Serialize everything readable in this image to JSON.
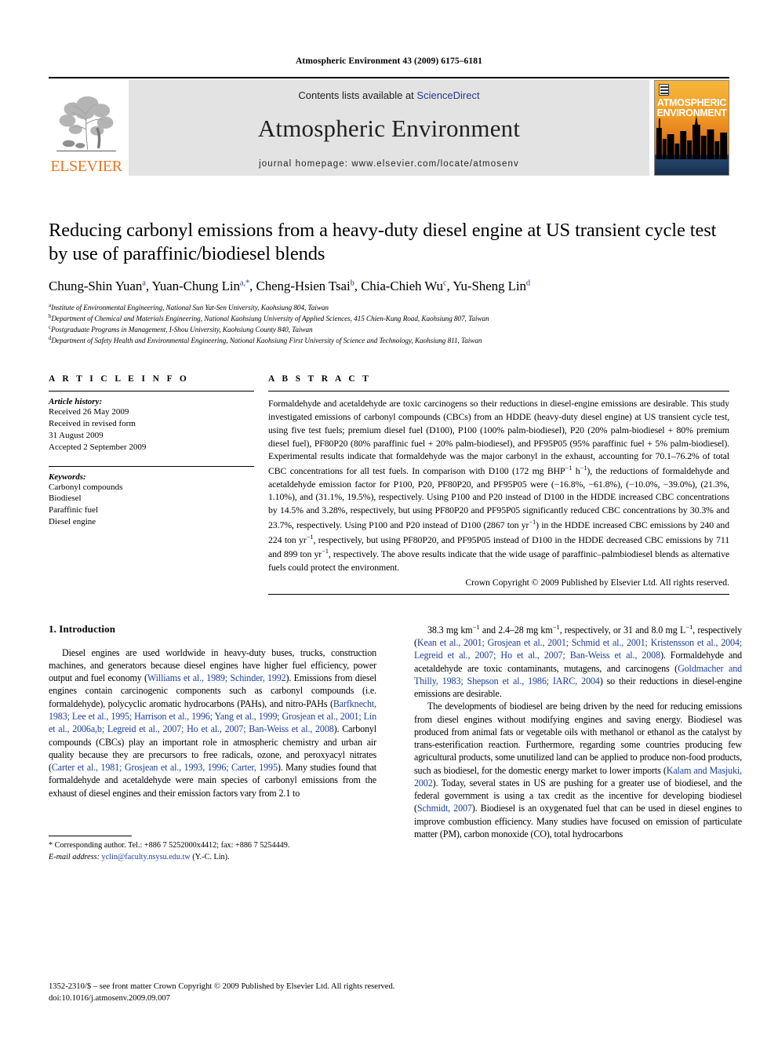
{
  "running_head": "Atmospheric Environment 43 (2009) 6175–6181",
  "masthead": {
    "contents_prefix": "Contents lists available at ",
    "sciencedirect": "ScienceDirect",
    "journal_title": "Atmospheric Environment",
    "homepage": "journal homepage: www.elsevier.com/locate/atmosenv",
    "publisher_name": "ELSEVIER",
    "cover_title_line1": "ATMOSPHERIC",
    "cover_title_line2": "ENVIRONMENT",
    "accent_orange": "#E87722",
    "link_blue": "#2b3a8f",
    "masthead_bg": "#e3e3e3"
  },
  "article": {
    "title": "Reducing carbonyl emissions from a heavy-duty diesel engine at US transient cycle test by use of paraffinic/biodiesel blends",
    "authors": [
      {
        "name": "Chung-Shin Yuan",
        "marks": "a",
        "sep": ", "
      },
      {
        "name": "Yuan-Chung Lin",
        "marks": "a,*",
        "sep": ", "
      },
      {
        "name": "Cheng-Hsien Tsai",
        "marks": "b",
        "sep": ", "
      },
      {
        "name": "Chia-Chieh Wu",
        "marks": "c",
        "sep": ", "
      },
      {
        "name": "Yu-Sheng Lin",
        "marks": "d",
        "sep": ""
      }
    ],
    "affiliations": [
      {
        "mark": "a",
        "text": "Institute of Environmental Engineering, National Sun Yat-Sen University, Kaohsiung 804, Taiwan"
      },
      {
        "mark": "b",
        "text": "Department of Chemical and Materials Engineering, National Kaohsiung University of Applied Sciences, 415 Chien-Kung Road, Kaohsiung 807, Taiwan"
      },
      {
        "mark": "c",
        "text": "Postgraduate Programs in Management, I-Shou University, Kaohsiung County 840, Taiwan"
      },
      {
        "mark": "d",
        "text": "Department of Safety Health and Environmental Engineering, National Kaohsiung First University of Science and Technology, Kaohsiung 811, Taiwan"
      }
    ]
  },
  "article_info": {
    "heading": "A R T I C L E  I N F O",
    "history_label": "Article history:",
    "history": [
      "Received 26 May 2009",
      "Received in revised form",
      "31 August 2009",
      "Accepted 2 September 2009"
    ],
    "keywords_label": "Keywords:",
    "keywords": [
      "Carbonyl compounds",
      "Biodiesel",
      "Paraffinic fuel",
      "Diesel engine"
    ]
  },
  "abstract": {
    "heading": "A B S T R A C T",
    "paragraph_html": "Formaldehyde and acetaldehyde are toxic carcinogens so their reductions in diesel-engine emissions are desirable. This study investigated emissions of carbonyl compounds (CBCs) from an HDDE (heavy-duty diesel engine) at US transient cycle test, using five test fuels; premium diesel fuel (D100), P100 (100% palm-biodiesel), P20 (20% palm-biodiesel + 80% premium diesel fuel), PF80P20 (80% paraffinic fuel + 20% palm-biodiesel), and PF95P05 (95% paraffinic fuel + 5% palm-biodiesel). Experimental results indicate that formaldehyde was the major carbonyl in the exhaust, accounting for 70.1–76.2% of total CBC concentrations for all test fuels. In comparison with D100 (172 mg BHP<sup class=\"sm\">−1</sup> h<sup class=\"sm\">−1</sup>), the reductions of formaldehyde and acetaldehyde emission factor for P100, P20, PF80P20, and PF95P05 were (−16.8%, −61.8%), (−10.0%, −39.0%), (21.3%, 1.10%), and (31.1%, 19.5%), respectively. Using P100 and P20 instead of D100 in the HDDE increased CBC concentrations by 14.5% and 3.28%, respectively, but using PF80P20 and PF95P05 significantly reduced CBC concentrations by 30.3% and 23.7%, respectively. Using P100 and P20 instead of D100 (2867 ton yr<sup class=\"sm\">−1</sup>) in the HDDE increased CBC emissions by 240 and 224 ton yr<sup class=\"sm\">−1</sup>, respectively, but using PF80P20, and PF95P05 instead of D100 in the HDDE decreased CBC emissions by 711 and 899 ton yr<sup class=\"sm\">−1</sup>, respectively. The above results indicate that the wide usage of paraffinic–palmbiodiesel blends as alternative fuels could protect the environment.",
    "copyright": "Crown Copyright © 2009 Published by Elsevier Ltd. All rights reserved."
  },
  "introduction": {
    "section_number_title": "1.  Introduction",
    "left_paragraph_html": "Diesel engines are used worldwide in heavy-duty buses, trucks, construction machines, and generators because diesel engines have higher fuel efficiency, power output and fuel economy (<span class=\"ref\">Williams et al., 1989; Schinder, 1992</span>). Emissions from diesel engines contain carcinogenic components such as carbonyl compounds (i.e. formaldehyde), polycyclic aromatic hydrocarbons (PAHs), and nitro-PAHs (<span class=\"ref\">Barfknecht, 1983; Lee et al., 1995; Harrison et al., 1996; Yang et al., 1999; Grosjean et al., 2001; Lin et al., 2006a,b; Legreid et al., 2007; Ho et al., 2007; Ban-Weiss et al., 2008</span>). Carbonyl compounds (CBCs) play an important role in atmospheric chemistry and urban air quality because they are precursors to free radicals, ozone, and peroxyacyl nitrates (<span class=\"ref\">Carter et al., 1981; Grosjean et al., 1993, 1996; Carter, 1995</span>). Many studies found that formaldehyde and acetaldehyde were main species of carbonyl emissions from the exhaust of diesel engines and their emission factors vary from 2.1 to",
    "right_paragraph1_html": "38.3 mg km<sup class=\"sm\">−1</sup> and 2.4–28 mg km<sup class=\"sm\">−1</sup>, respectively, or 31 and 8.0 mg L<sup class=\"sm\">−1</sup>, respectively (<span class=\"ref\">Kean et al., 2001; Grosjean et al., 2001; Schmid et al., 2001; Kristensson et al., 2004; Legreid et al., 2007; Ho et al., 2007; Ban-Weiss et al., 2008</span>). Formaldehyde and acetaldehyde are toxic contaminants, mutagens, and carcinogens (<span class=\"ref\">Goldmacher and Thilly, 1983; Shepson et al., 1986; IARC, 2004</span>) so their reductions in diesel-engine emissions are desirable.",
    "right_paragraph2_html": "The developments of biodiesel are being driven by the need for reducing emissions from diesel engines without modifying engines and saving energy. Biodiesel was produced from animal fats or vegetable oils with methanol or ethanol as the catalyst by trans-esterification reaction. Furthermore, regarding some countries producing few agricultural products, some unutilized land can be applied to produce non-food products, such as biodiesel, for the domestic energy market to lower imports (<span class=\"ref\">Kalam and Masjuki, 2002</span>). Today, several states in US are pushing for a greater use of biodiesel, and the federal government is using a tax credit as the incentive for developing biodiesel (<span class=\"ref\">Schmidt, 2007</span>). Biodiesel is an oxygenated fuel that can be used in diesel engines to improve combustion efficiency. Many studies have focused on emission of particulate matter (PM), carbon monoxide (CO), total hydrocarbons"
  },
  "footnote": {
    "corresponding_html": "* Corresponding author. Tel.: +886 7 5252000x4412; fax: +886 7 5254449.",
    "email_label": "E-mail address:",
    "email": "yclin@faculty.nsysu.edu.tw",
    "email_person": "(Y.-C. Lin)."
  },
  "page_footer": {
    "line1": "1352-2310/$ – see front matter Crown Copyright © 2009 Published by Elsevier Ltd. All rights reserved.",
    "line2": "doi:10.1016/j.atmosenv.2009.09.007"
  }
}
